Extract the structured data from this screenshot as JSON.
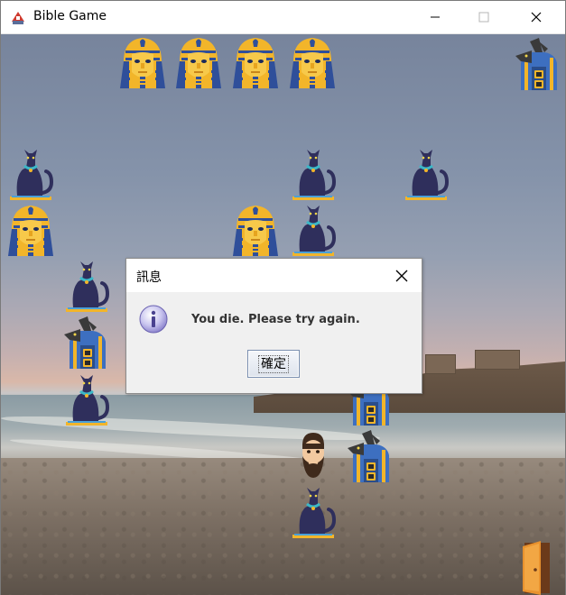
{
  "window": {
    "title": "Bible Game",
    "controls": [
      "minimize",
      "maximize",
      "close"
    ]
  },
  "game": {
    "scene": "beach-at-dusk",
    "pieces": {
      "pharaoh_icon": "pharaoh-mask-icon",
      "cat_icon": "egyptian-cat-icon",
      "anubis_icon": "anubis-guard-icon",
      "player_icon": "bearded-man-icon",
      "exit_icon": "door-icon"
    }
  },
  "dialog": {
    "title": "訊息",
    "message": "You die. Please try again.",
    "ok_label": "確定",
    "icon": "info-icon"
  },
  "colors": {
    "pharaoh_gold": "#f2b52a",
    "pharaoh_blue": "#2f4f9a",
    "cat_body": "#2f2f5c",
    "anubis_blue": "#3d6fc0",
    "door_orange": "#e08a2e"
  }
}
